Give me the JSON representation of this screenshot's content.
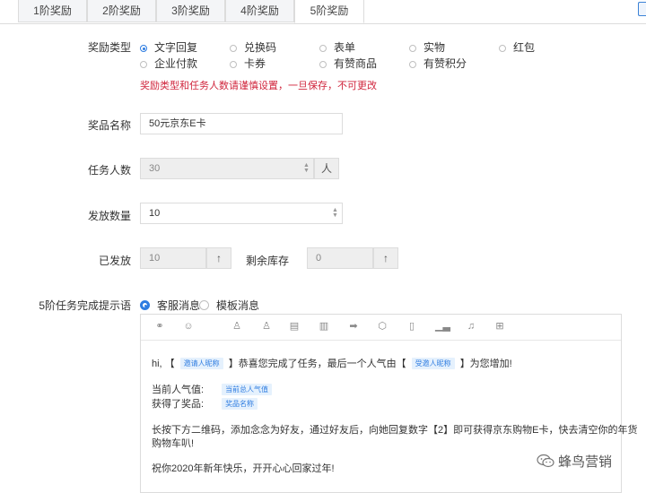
{
  "tabs": [
    "1阶奖励",
    "2阶奖励",
    "3阶奖励",
    "4阶奖励",
    "5阶奖励"
  ],
  "reward_type": {
    "label": "奖励类型",
    "options": [
      "文字回复",
      "兑换码",
      "表单",
      "实物",
      "红包",
      "企业付款",
      "卡券",
      "有赞商品",
      "有赞积分"
    ],
    "selected": "文字回复",
    "warning": "奖励类型和任务人数请谨慎设置，一旦保存，不可更改"
  },
  "prize_name": {
    "label": "奖品名称",
    "value": "50元京东E卡"
  },
  "task_count": {
    "label": "任务人数",
    "value": "30",
    "unit": "人"
  },
  "issue_qty": {
    "label": "发放数量",
    "value": "10"
  },
  "issued": {
    "label": "已发放",
    "value": "10"
  },
  "remaining": {
    "label": "剩余库存",
    "value": "0"
  },
  "completion_msg": {
    "label": "5阶任务完成提示语",
    "options": [
      "客服消息",
      "模板消息"
    ],
    "selected": "客服消息"
  },
  "editor": {
    "line1_a": "hi, 【",
    "tag_inviter": "邀请人昵称",
    "line1_b": "】恭喜您完成了任务，最后一个人气由【",
    "tag_invitee": "受邀人昵称",
    "line1_c": "】为您增加!",
    "line2_label": "当前人气值:",
    "tag_popularity": "当前总人气值",
    "line3_label": "获得了奖品:",
    "tag_prize": "奖品名称",
    "line4": "长按下方二维码，添加念念为好友，通过好友后，向她回复数字【2】即可获得京东购物E卡，快去清空你的年货",
    "line5": "购物车叭!",
    "line6": "祝你2020年新年快乐，开开心心回家过年!"
  },
  "watermark": "蜂鸟营销",
  "icons": {
    "toolbar": [
      "link-icon",
      "emoji-icon",
      "user-icon",
      "users-icon",
      "document-icon",
      "documents-icon",
      "arrow-right-icon",
      "box-icon",
      "clipboard-icon",
      "bar-chart-icon",
      "bell-icon",
      "gift-icon"
    ]
  },
  "colors": {
    "accent": "#2f7de1",
    "warning": "#d0263d",
    "tag_bg": "#e5f1fd"
  }
}
